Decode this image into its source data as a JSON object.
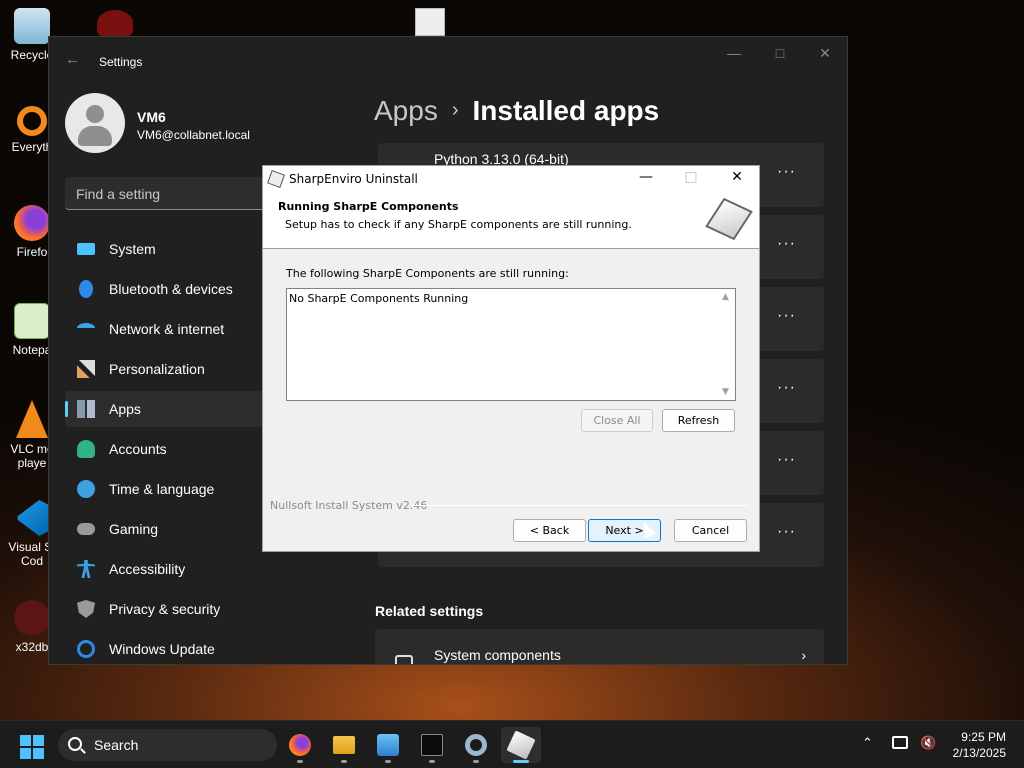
{
  "desktop": {
    "icons": [
      {
        "label": "Recycle",
        "icon": "recycle-bin-icon"
      },
      {
        "label": "Everyth",
        "icon": "everything-search-icon"
      },
      {
        "label": "Firefo",
        "icon": "firefox-icon"
      },
      {
        "label": "Notepa",
        "icon": "notepad-plus-plus-icon"
      },
      {
        "label": "VLC me\nplaye",
        "icon": "vlc-cone-icon"
      },
      {
        "label": "Visual St\nCod",
        "icon": "vscode-icon"
      },
      {
        "label": "x32db",
        "icon": "x32dbg-icon"
      }
    ]
  },
  "settings": {
    "title": "Settings",
    "profile": {
      "name": "VM6",
      "email": "VM6@collabnet.local"
    },
    "search_placeholder": "Find a setting",
    "nav": [
      {
        "label": "System",
        "icon": "system-monitor-icon",
        "color": "#4cc2ff"
      },
      {
        "label": "Bluetooth & devices",
        "icon": "bluetooth-icon",
        "color": "#2b8be6"
      },
      {
        "label": "Network & internet",
        "icon": "wifi-icon",
        "color": "#36a5e8"
      },
      {
        "label": "Personalization",
        "icon": "brush-icon",
        "color": "#e0a060"
      },
      {
        "label": "Apps",
        "icon": "apps-grid-icon",
        "color": "#8a9aae",
        "active": true
      },
      {
        "label": "Accounts",
        "icon": "person-icon",
        "color": "#2fb387"
      },
      {
        "label": "Time & language",
        "icon": "globe-clock-icon",
        "color": "#3fa0e0"
      },
      {
        "label": "Gaming",
        "icon": "gamepad-icon",
        "color": "#9a9a9a"
      },
      {
        "label": "Accessibility",
        "icon": "accessibility-icon",
        "color": "#3aa0e8"
      },
      {
        "label": "Privacy & security",
        "icon": "shield-icon",
        "color": "#9a9a9a"
      },
      {
        "label": "Windows Update",
        "icon": "update-icon",
        "color": "#2b8be6"
      }
    ],
    "breadcrumb": {
      "parent": "Apps",
      "current": "Installed apps"
    },
    "apps": [
      {
        "name": "Python 3.13.0 (64-bit)"
      }
    ],
    "more_label": "···",
    "related_heading": "Related settings",
    "system_components": "System components"
  },
  "dialog": {
    "title": "SharpEnviro Uninstall",
    "heading": "Running SharpE Components",
    "subheading": "Setup has to check if any SharpE components are still running.",
    "list_label": "The following SharpE Components are still running:",
    "list_items": [
      "No SharpE Components Running"
    ],
    "close_all": "Close All",
    "refresh": "Refresh",
    "brand": "Nullsoft Install System v2.46",
    "back": "< Back",
    "next": "Next >",
    "cancel": "Cancel"
  },
  "taskbar": {
    "search_label": "Search",
    "apps": [
      "firefox-icon",
      "file-explorer-icon",
      "photos-icon",
      "terminal-icon",
      "settings-gear-icon",
      "installer-icon"
    ],
    "time": "9:25 PM",
    "date": "2/13/2025"
  },
  "colors": {
    "accent": "#60cdff",
    "settings_bg": "#202020",
    "card": "#2b2b2b"
  }
}
